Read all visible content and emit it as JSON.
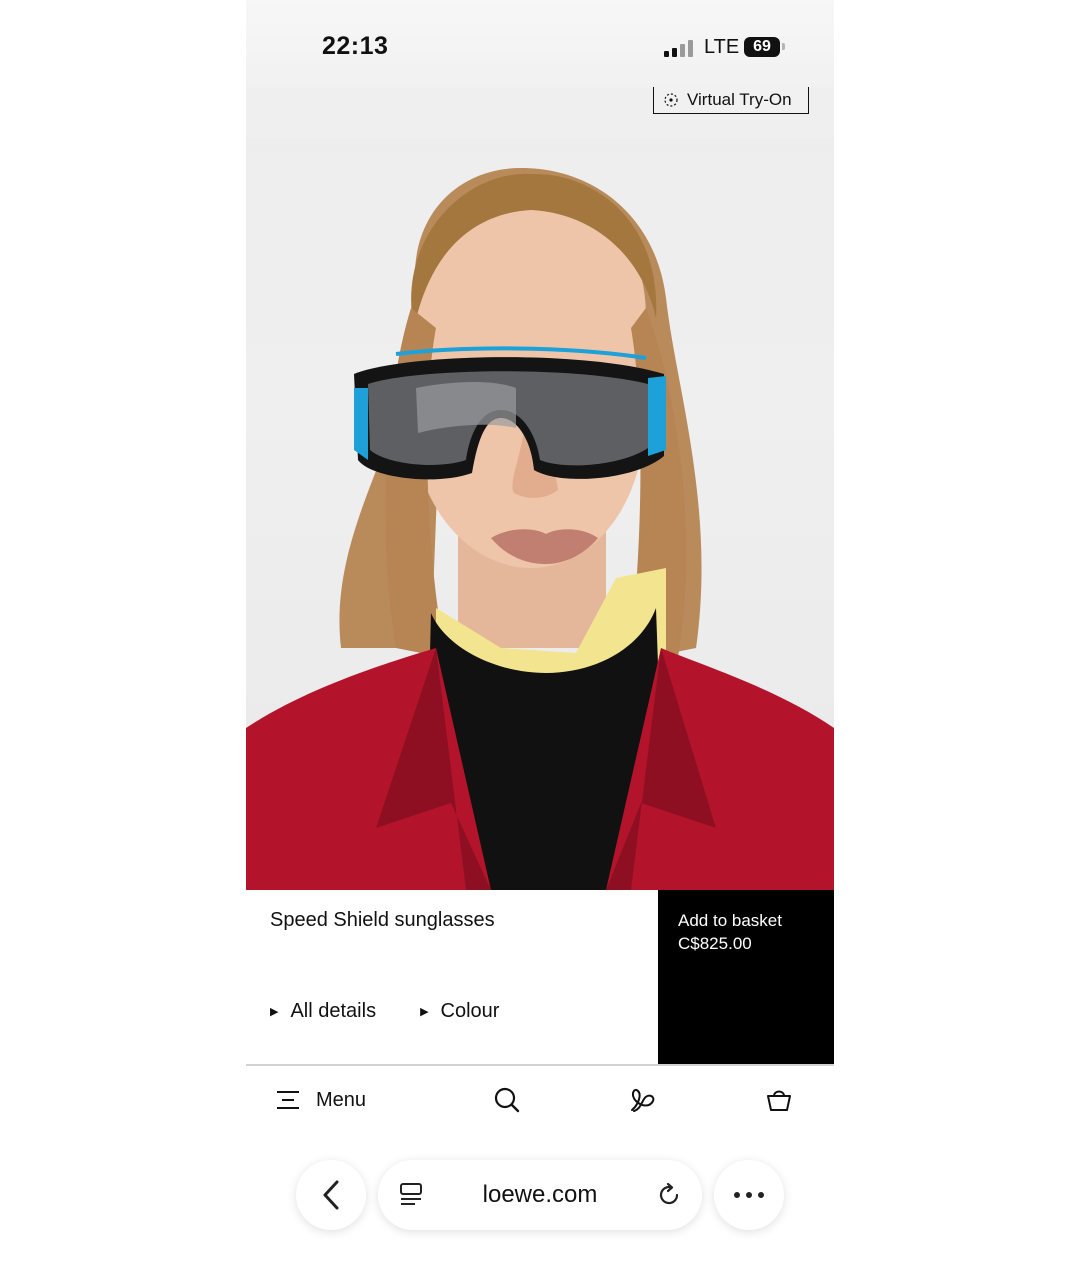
{
  "status": {
    "time": "22:13",
    "network": "LTE",
    "battery": "69"
  },
  "hero": {
    "tryon_label": "Virtual Try-On"
  },
  "product": {
    "name": "Speed Shield sunglasses",
    "buy_label": "Add to basket",
    "price": "C$825.00",
    "options": [
      "All details",
      "Colour"
    ]
  },
  "nav": {
    "menu_label": "Menu"
  },
  "browser": {
    "url": "loewe.com"
  },
  "colors": {
    "accent": "#000000",
    "coat": "#b4142b",
    "lens_trim": "#1ea0d8"
  }
}
